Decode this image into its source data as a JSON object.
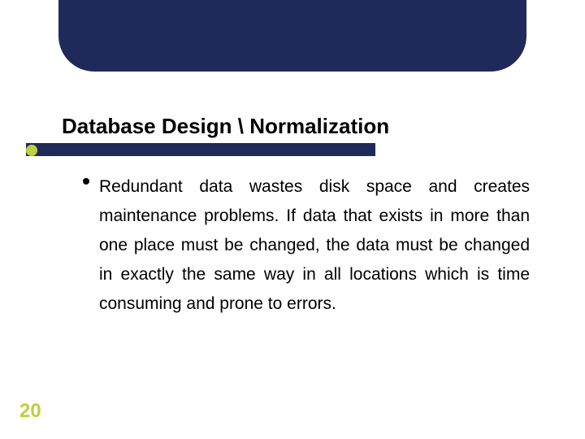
{
  "slide": {
    "title": "Database Design  \\  Normalization",
    "bullets": [
      "Redundant data wastes disk space and creates maintenance problems. If data that exists in more than one place must be changed, the data must be changed in exactly the same way in all locations which is time consuming and prone to errors."
    ],
    "page_number": "20"
  },
  "colors": {
    "header_navy": "#1f2a5a",
    "accent_olive": "#bfcf3f"
  }
}
